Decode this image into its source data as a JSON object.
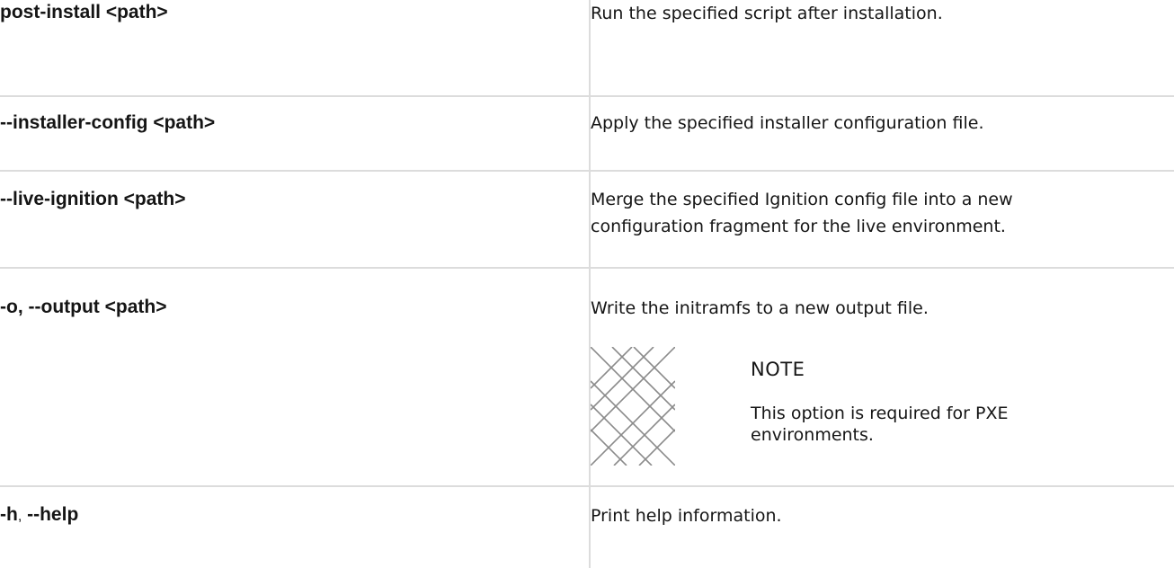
{
  "rows": [
    {
      "option": "post-install <path>",
      "description": "Run the specified script after installation."
    },
    {
      "option": "--installer-config <path>",
      "description": "Apply the specified installer configuration file."
    },
    {
      "option": "--live-ignition <path>",
      "description_line1": "Merge the specified Ignition config file into a new",
      "description_line2": "configuration fragment for the live environment."
    },
    {
      "option_part1": "-o",
      "option_separator": ",",
      "option_part2": " --output <path>",
      "description": "Write the initramfs to a new output file.",
      "note": {
        "title": "NOTE",
        "text_line1": "This option is required for PXE",
        "text_line2": "environments."
      }
    },
    {
      "option_part1": "-h",
      "option_separator": ",",
      "option_part2": " --help",
      "description": "Print help information."
    }
  ],
  "icons": {
    "note": "note-crosshatch-icon"
  },
  "colors": {
    "text": "#151515",
    "border": "#dcdcdc",
    "icon": "#8a8a8a"
  }
}
